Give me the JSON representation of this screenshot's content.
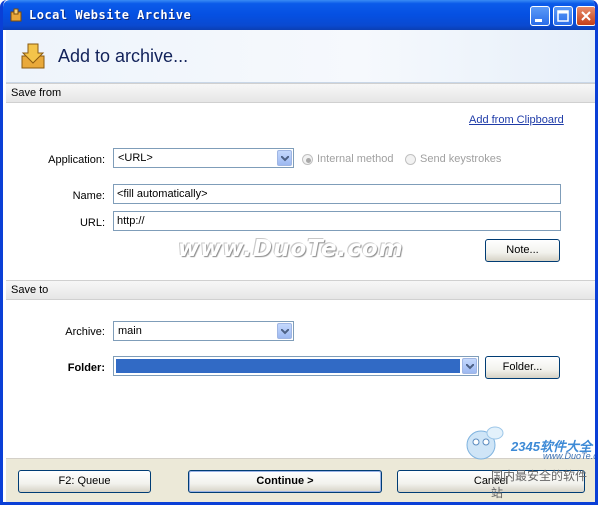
{
  "window": {
    "title": "Local Website Archive"
  },
  "header": {
    "title": "Add to archive..."
  },
  "save_from": {
    "section_label": "Save from",
    "add_from_clipboard": "Add from Clipboard",
    "application_label": "Application:",
    "application_value": "<URL>",
    "radio_internal": "Internal method",
    "radio_send_keys": "Send keystrokes",
    "name_label": "Name:",
    "name_value": "<fill automatically>",
    "url_label": "URL:",
    "url_value": "http://",
    "note_button": "Note..."
  },
  "save_to": {
    "section_label": "Save to",
    "archive_label": "Archive:",
    "archive_value": "main",
    "folder_label": "Folder:",
    "folder_value": "",
    "folder_button": "Folder..."
  },
  "footer": {
    "queue_button": "F2: Queue",
    "continue_button": "Continue >",
    "cancel_button": "Cancel"
  },
  "watermarks": {
    "main": "www.DuoTe.com",
    "brand": "2345软件大全",
    "site": "www.DuoTe.com",
    "slogan": "国内最安全的软件站"
  },
  "colors": {
    "titlebar": "#0550e2",
    "selection": "#316ac5",
    "link": "#1e3ba8"
  }
}
